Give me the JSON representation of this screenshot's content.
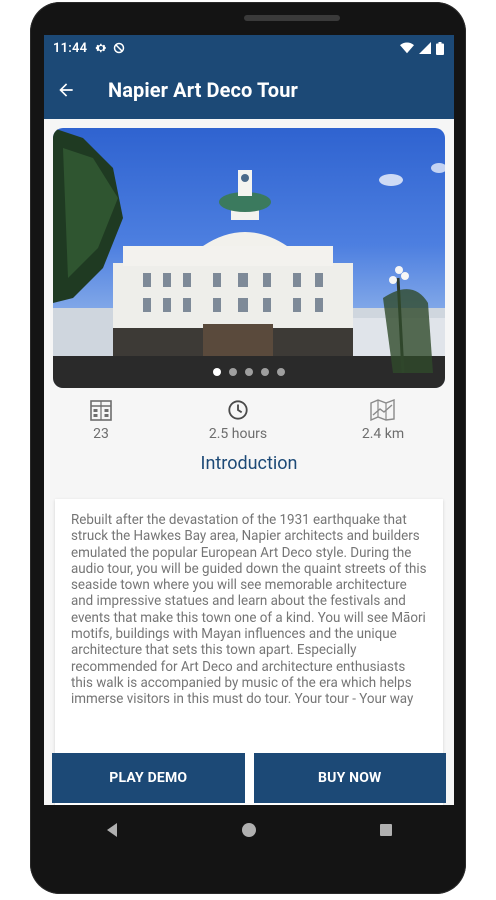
{
  "status_bar": {
    "time": "11:44"
  },
  "app_bar": {
    "title": "Napier Art Deco Tour"
  },
  "carousel": {
    "slide_count": 5,
    "active_index": 0
  },
  "stats": [
    {
      "icon": "buildings-icon",
      "value": "23"
    },
    {
      "icon": "clock-icon",
      "value": "2.5 hours"
    },
    {
      "icon": "map-distance-icon",
      "value": "2.4 km"
    }
  ],
  "section": {
    "title": "Introduction"
  },
  "description": "Rebuilt after the devastation of the 1931 earthquake that struck the Hawkes Bay area, Napier architects and builders emulated the popular European Art Deco style. During the audio tour, you will be guided down the quaint streets of this seaside town where you will see memorable architecture and impressive statues and learn about the festivals and events that make this town one of a kind. You will see Māori motifs, buildings with Mayan influences and the unique architecture that sets this town apart.  Especially recommended for Art Deco and architecture enthusiasts this walk is accompanied by music of the era which helps immerse visitors in this must do tour. Your tour - Your way",
  "buttons": {
    "play_demo": "PLAY DEMO",
    "buy_now": "BUY NOW"
  },
  "colors": {
    "primary": "#1c4976",
    "text_muted": "#757575"
  }
}
